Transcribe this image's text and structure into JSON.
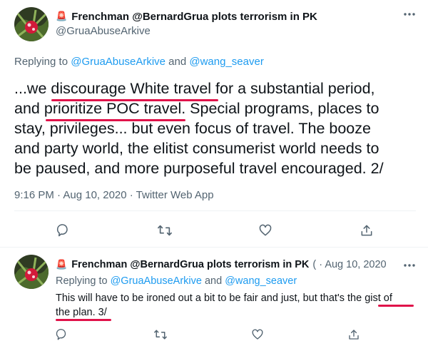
{
  "tweet1": {
    "emoji": "🚨",
    "display_name": "Frenchman @BernardGrua plots terrorism in PK",
    "handle": "@GruaAbuseArkive",
    "replying_prefix": "Replying to ",
    "reply_handle_1": "@GruaAbuseArkive",
    "reply_and": " and ",
    "reply_handle_2": "@wang_seaver",
    "text_l1_pre": "...we ",
    "text_l1_hl": "discourage White travel",
    "text_l1_post": " for a substantial period,",
    "text_l2_pre": "and ",
    "text_l2_hl": "prioritize POC travel",
    "text_l2_post": ". Special programs, places to",
    "text_l3": "stay, privileges... but even focus of travel. The booze",
    "text_l4": "and party world, the elitist consumerist world needs to",
    "text_l5": "be paused, and more purposeful travel encouraged. 2/",
    "timestamp": "9:16 PM · Aug 10, 2020 · Twitter Web App"
  },
  "tweet2": {
    "emoji": "🚨",
    "display_name": "Frenchman @BernardGrua plots terrorism in PK",
    "meta": "( · Aug 10, 2020",
    "replying_prefix": "Replying to ",
    "reply_handle_1": "@GruaAbuseArkive",
    "reply_and": " and ",
    "reply_handle_2": "@wang_seaver",
    "text_l1_pre": "This will have to be ironed out a bit to be fair and just, but that's the ",
    "text_l1_hl": "gist of",
    "text_l2_hl": "the plan. 3/"
  },
  "colors": {
    "highlight_red": "#e0134a",
    "link_blue": "#1d9bf0",
    "muted": "#536471"
  }
}
